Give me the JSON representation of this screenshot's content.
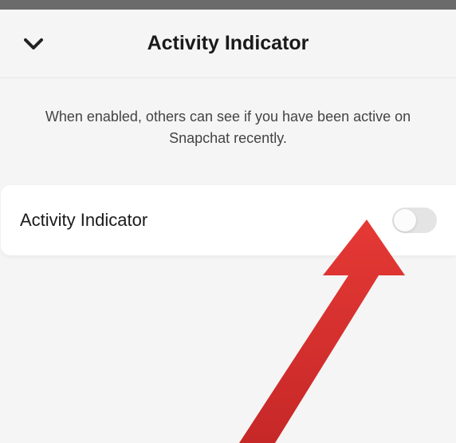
{
  "header": {
    "title": "Activity Indicator"
  },
  "description": {
    "text": "When enabled, others can see if you have been active on Snapchat recently."
  },
  "setting": {
    "label": "Activity Indicator",
    "enabled": false
  }
}
